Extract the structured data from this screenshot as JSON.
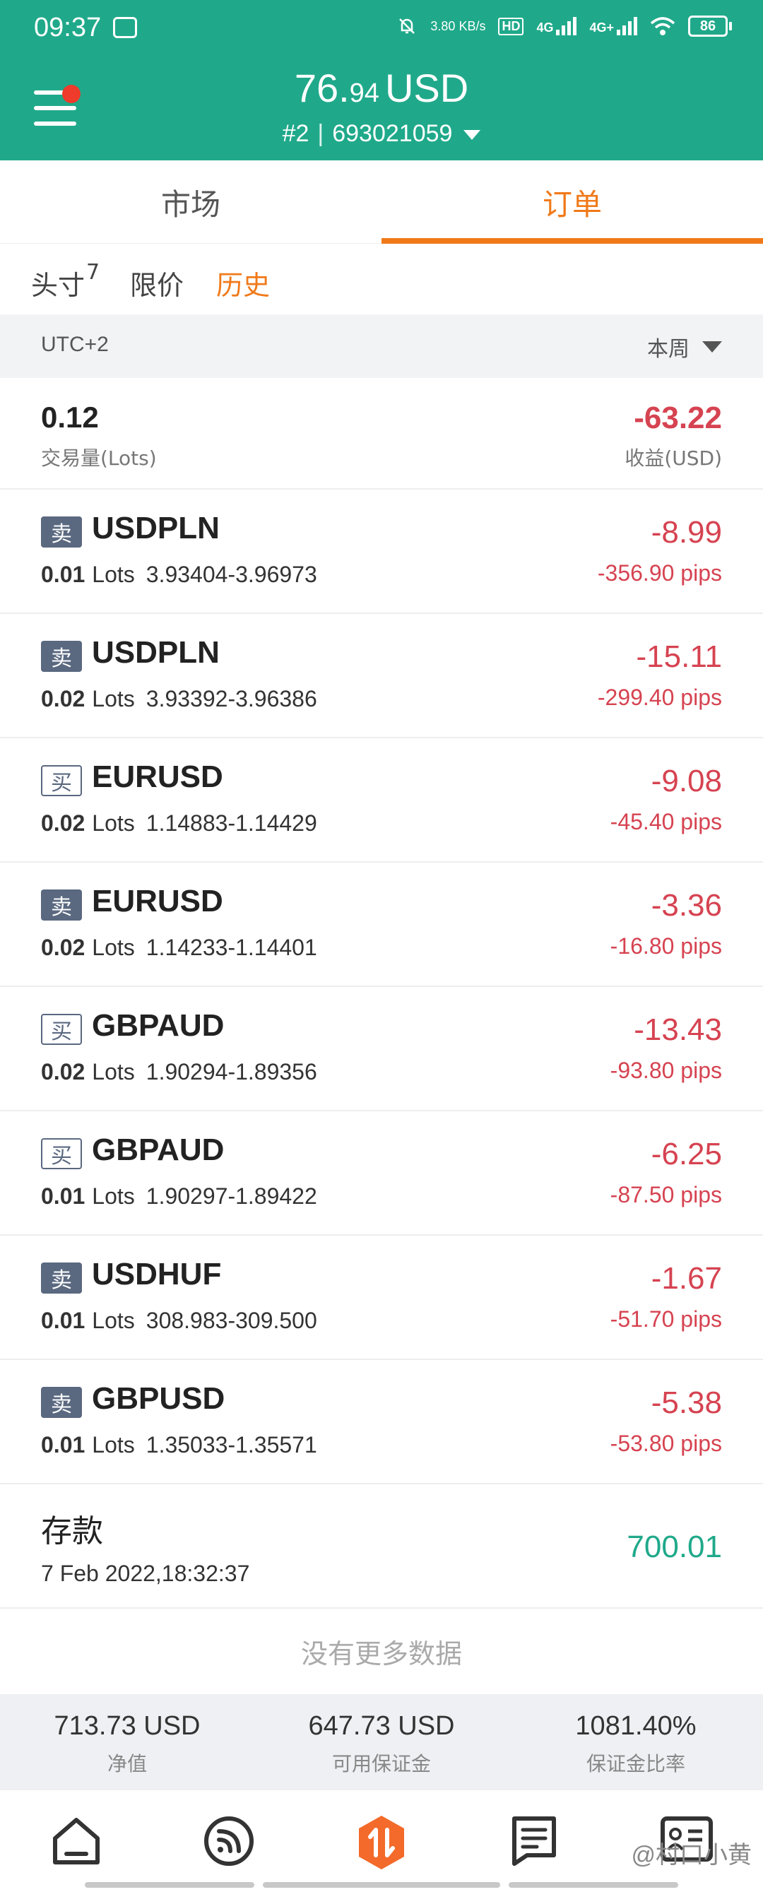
{
  "status_bar": {
    "time": "09:37",
    "net_speed": "3.80 KB/s",
    "hd": "HD",
    "signal1": "4G",
    "signal2": "4G+",
    "battery": "86"
  },
  "header": {
    "balance_int": "76.",
    "balance_dec": "94",
    "currency": "USD",
    "account_index": "#2",
    "account_number": "693021059"
  },
  "tabs": {
    "market": "市场",
    "orders": "订单"
  },
  "sub_tabs": {
    "positions": "头寸",
    "positions_count": "7",
    "limit": "限价",
    "history": "历史"
  },
  "filter": {
    "timezone": "UTC+2",
    "period": "本周"
  },
  "summary": {
    "volume": "0.12",
    "volume_label": "交易量(Lots)",
    "profit": "-63.22",
    "profit_label": "收益(USD)"
  },
  "orders": [
    {
      "side": "卖",
      "symbol": "USDPLN",
      "lots": "0.01",
      "unit": "Lots",
      "range": "3.93404-3.96973",
      "profit": "-8.99",
      "pips": "-356.90 pips"
    },
    {
      "side": "卖",
      "symbol": "USDPLN",
      "lots": "0.02",
      "unit": "Lots",
      "range": "3.93392-3.96386",
      "profit": "-15.11",
      "pips": "-299.40 pips"
    },
    {
      "side": "买",
      "symbol": "EURUSD",
      "lots": "0.02",
      "unit": "Lots",
      "range": "1.14883-1.14429",
      "profit": "-9.08",
      "pips": "-45.40 pips"
    },
    {
      "side": "卖",
      "symbol": "EURUSD",
      "lots": "0.02",
      "unit": "Lots",
      "range": "1.14233-1.14401",
      "profit": "-3.36",
      "pips": "-16.80 pips"
    },
    {
      "side": "买",
      "symbol": "GBPAUD",
      "lots": "0.02",
      "unit": "Lots",
      "range": "1.90294-1.89356",
      "profit": "-13.43",
      "pips": "-93.80 pips"
    },
    {
      "side": "买",
      "symbol": "GBPAUD",
      "lots": "0.01",
      "unit": "Lots",
      "range": "1.90297-1.89422",
      "profit": "-6.25",
      "pips": "-87.50 pips"
    },
    {
      "side": "卖",
      "symbol": "USDHUF",
      "lots": "0.01",
      "unit": "Lots",
      "range": "308.983-309.500",
      "profit": "-1.67",
      "pips": "-51.70 pips"
    },
    {
      "side": "卖",
      "symbol": "GBPUSD",
      "lots": "0.01",
      "unit": "Lots",
      "range": "1.35033-1.35571",
      "profit": "-5.38",
      "pips": "-53.80 pips"
    }
  ],
  "deposit": {
    "title": "存款",
    "date": "7 Feb 2022,18:32:37",
    "amount": "700.01"
  },
  "no_more": "没有更多数据",
  "account_footer": {
    "equity": "713.73 USD",
    "equity_label": "净值",
    "free_margin": "647.73 USD",
    "free_margin_label": "可用保证金",
    "margin_level": "1081.40%",
    "margin_level_label": "保证金比率"
  },
  "watermark": "@村口小黄",
  "colors": {
    "brand": "#1fa98a",
    "accent": "#f07a1a",
    "loss": "#d64351",
    "gain": "#1fa98a"
  },
  "nav_icons": [
    "home-icon",
    "feed-icon",
    "trade-icon",
    "orders-list-icon",
    "profile-card-icon"
  ]
}
